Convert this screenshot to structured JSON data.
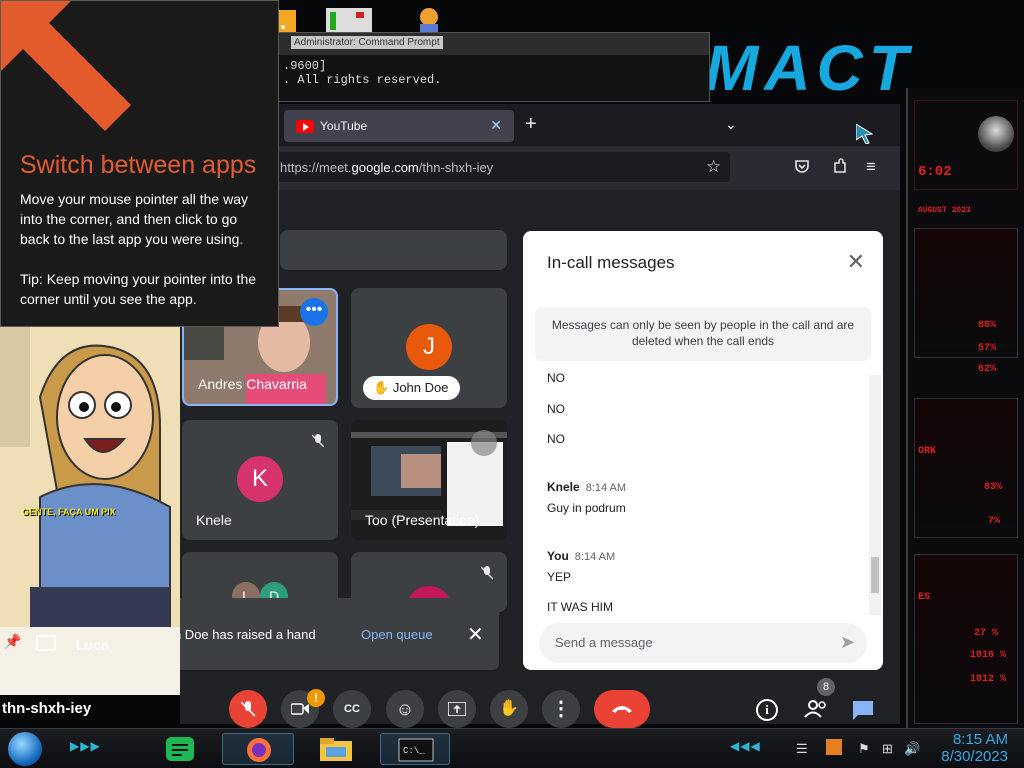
{
  "desktop": {
    "logo_text": "MACT"
  },
  "cmd_window": {
    "title": "Administrator: Command Prompt",
    "lines": [
      ".9600]",
      ". All rights reserved."
    ]
  },
  "browser": {
    "tab_title": "YouTube",
    "url_prefix": "https://meet.",
    "url_domain": "google.com",
    "url_path": "/thn-shxh-iey"
  },
  "tip": {
    "title": "Switch between apps",
    "body": "Move your mouse pointer all the way into the corner, and then click to go back to the last app you were using.",
    "tip": "Tip: Keep moving your pointer into the corner until you see the app."
  },
  "meet": {
    "meeting_code": "thn-shxh-iey",
    "participants": {
      "andres": "Andres Chavarria",
      "john_doe": "John Doe",
      "john_initial": "J",
      "knele": "Knele",
      "knele_initial": "K",
      "presentation": "Too (Presentation)",
      "tile5_initials": [
        "L",
        "D"
      ]
    },
    "participant_count": "8",
    "colors": {
      "john_avatar": "#e8590c",
      "knele_avatar": "#d6336c",
      "end_call": "#ea4335",
      "mic_off": "#ea4335",
      "accent": "#8ab4f8",
      "badge": "#f29900"
    }
  },
  "chat": {
    "title": "In-call messages",
    "notice": "Messages can only be seen by people in the call and are deleted when the call ends",
    "messages": [
      {
        "text": "NO"
      },
      {
        "text": "NO"
      },
      {
        "text": "NO"
      },
      {
        "sender": "Knele",
        "time": "8:14 AM",
        "text": "Guy in podrum"
      },
      {
        "sender": "You",
        "time": "8:14 AM",
        "text": "YEP"
      },
      {
        "text": "IT WAS HIM"
      }
    ],
    "input_placeholder": "Send a message"
  },
  "toast": {
    "text": "John Doe has raised a hand",
    "action": "Open queue"
  },
  "cartoon": {
    "caption": "GENTE, FAÇA UM PIX",
    "name_stub": "Luca"
  },
  "taskbar": {
    "time": "8:15 AM",
    "date": "8/30/2023"
  },
  "alienware": {
    "stats": [
      "6:02",
      "AUGUST 2023",
      "86%",
      "57%",
      "62%",
      "ORK",
      "83%",
      "7%",
      "ES",
      "27 %",
      "1016 %",
      "1012 %"
    ]
  }
}
